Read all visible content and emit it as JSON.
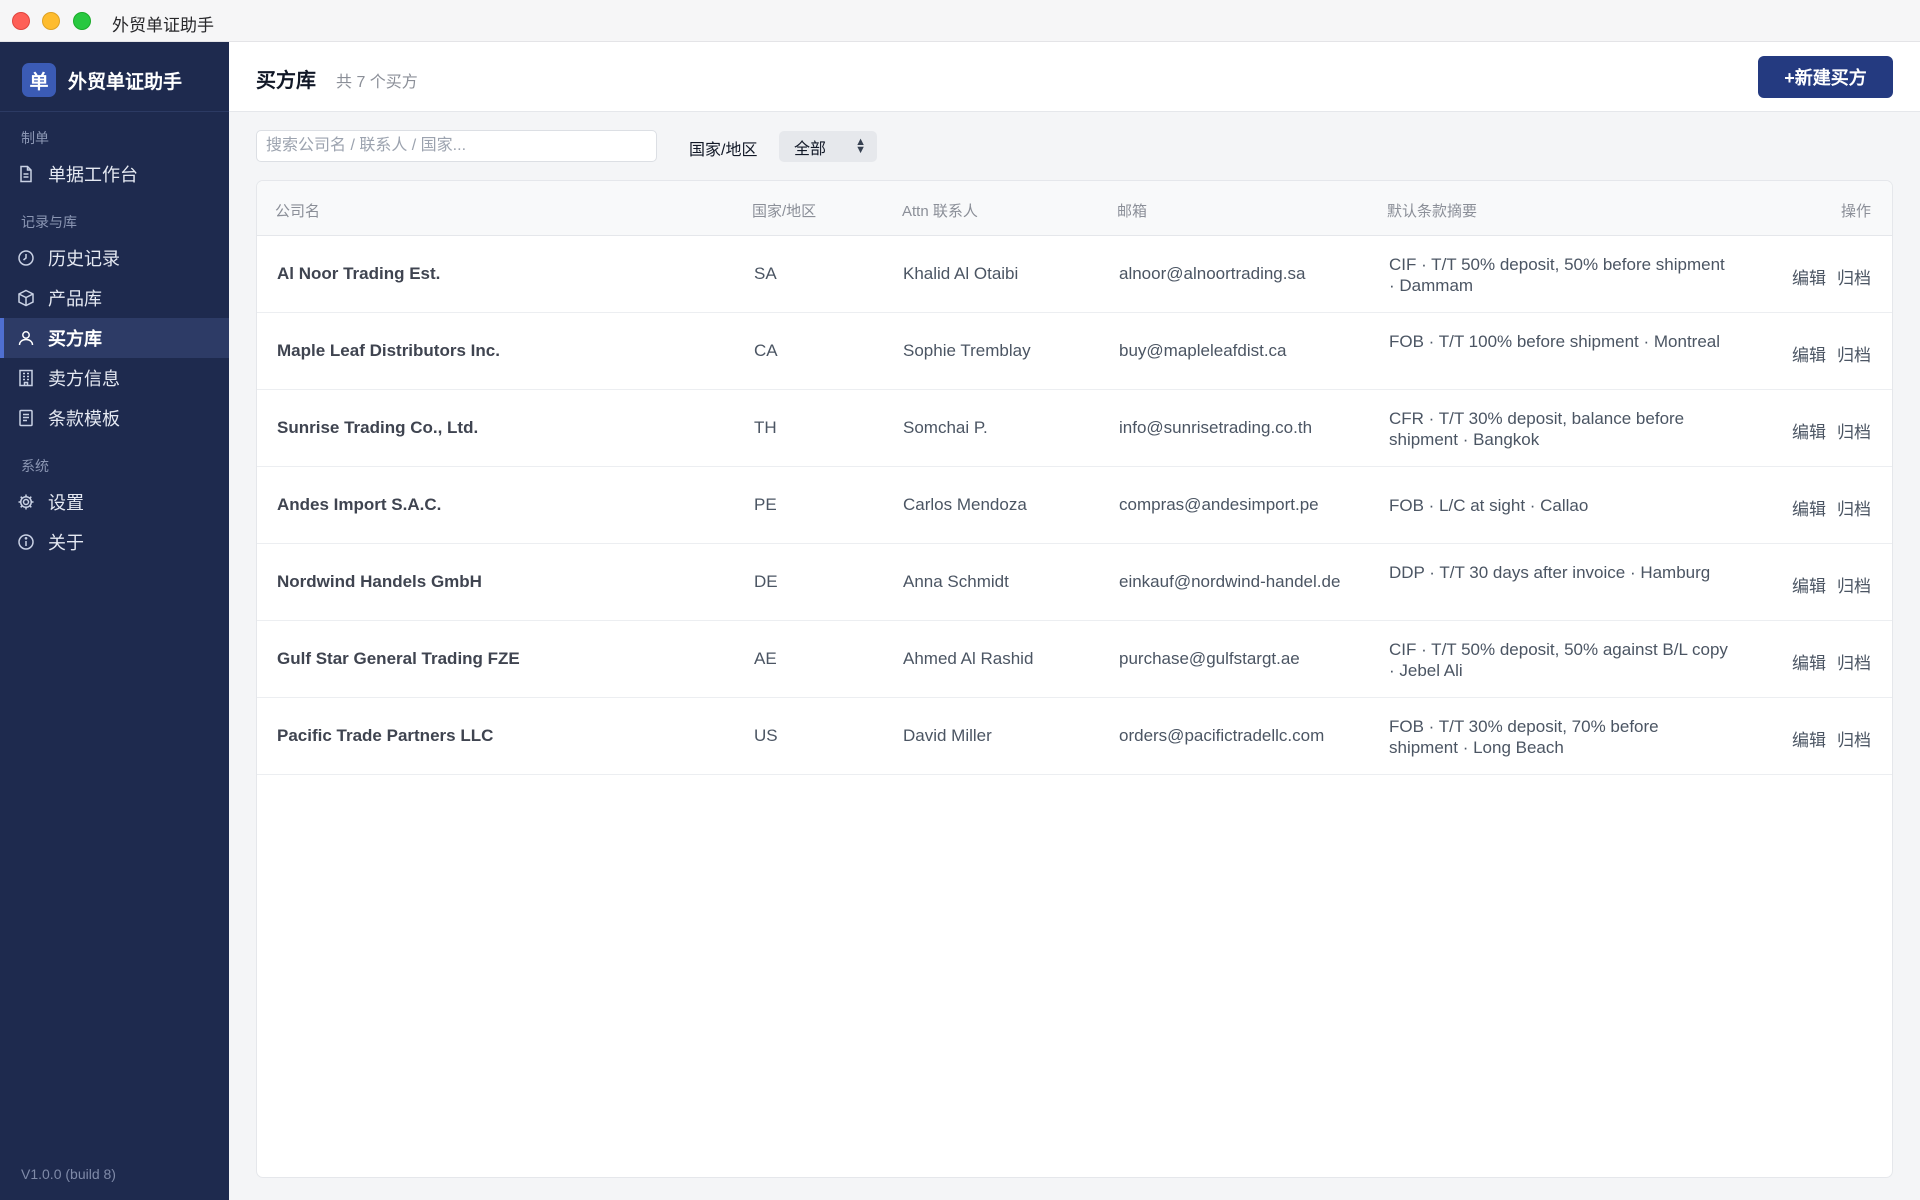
{
  "window": {
    "title": "外贸单证助手"
  },
  "sidebar": {
    "brand_logo": "单",
    "brand_name": "外贸单证助手",
    "sections": [
      {
        "label": "制单",
        "items": [
          {
            "label": "单据工作台",
            "icon": "document-icon"
          }
        ]
      },
      {
        "label": "记录与库",
        "items": [
          {
            "label": "历史记录",
            "icon": "clock-icon"
          },
          {
            "label": "产品库",
            "icon": "box-icon"
          },
          {
            "label": "买方库",
            "icon": "user-icon",
            "active": true
          },
          {
            "label": "卖方信息",
            "icon": "building-icon"
          },
          {
            "label": "条款模板",
            "icon": "template-icon"
          }
        ]
      },
      {
        "label": "系统",
        "items": [
          {
            "label": "设置",
            "icon": "gear-icon"
          },
          {
            "label": "关于",
            "icon": "info-icon"
          }
        ]
      }
    ],
    "version": "V1.0.0 (build 8)"
  },
  "header": {
    "title": "买方库",
    "count": "共 7 个买方",
    "new_button": "+新建买方"
  },
  "toolbar": {
    "search_placeholder": "搜索公司名 / 联系人 / 国家...",
    "filter_label": "国家/地区",
    "filter_value": "全部"
  },
  "table": {
    "columns": [
      "公司名",
      "国家/地区",
      "Attn 联系人",
      "邮箱",
      "默认条款摘要",
      "操作"
    ],
    "edit_label": "编辑",
    "archive_label": "归档",
    "rows": [
      {
        "company": "Al Noor Trading Est.",
        "country": "SA",
        "attn": "Khalid Al Otaibi",
        "email": "alnoor@alnoortrading.sa",
        "terms": "CIF · T/T 50% deposit, 50% before shipment · Dammam"
      },
      {
        "company": "Maple Leaf Distributors Inc.",
        "country": "CA",
        "attn": "Sophie Tremblay",
        "email": "buy@mapleleafdist.ca",
        "terms": "FOB · T/T 100% before shipment · Montreal"
      },
      {
        "company": "Sunrise Trading Co., Ltd.",
        "country": "TH",
        "attn": "Somchai P.",
        "email": "info@sunrisetrading.co.th",
        "terms": "CFR · T/T 30% deposit, balance before shipment · Bangkok"
      },
      {
        "company": "Andes Import S.A.C.",
        "country": "PE",
        "attn": "Carlos Mendoza",
        "email": "compras@andesimport.pe",
        "terms": "FOB · L/C at sight · Callao"
      },
      {
        "company": "Nordwind Handels GmbH",
        "country": "DE",
        "attn": "Anna Schmidt",
        "email": "einkauf@nordwind-handel.de",
        "terms": "DDP · T/T 30 days after invoice · Hamburg"
      },
      {
        "company": "Gulf Star General Trading FZE",
        "country": "AE",
        "attn": "Ahmed Al Rashid",
        "email": "purchase@gulfstargt.ae",
        "terms": "CIF · T/T 50% deposit, 50% against B/L copy · Jebel Ali"
      },
      {
        "company": "Pacific Trade Partners LLC",
        "country": "US",
        "attn": "David Miller",
        "email": "orders@pacifictradellc.com",
        "terms": "FOB · T/T 30% deposit, 70% before shipment · Long Beach"
      }
    ]
  },
  "colors": {
    "sidebar_bg": "#1e2a4e",
    "accent": "#243a80"
  }
}
